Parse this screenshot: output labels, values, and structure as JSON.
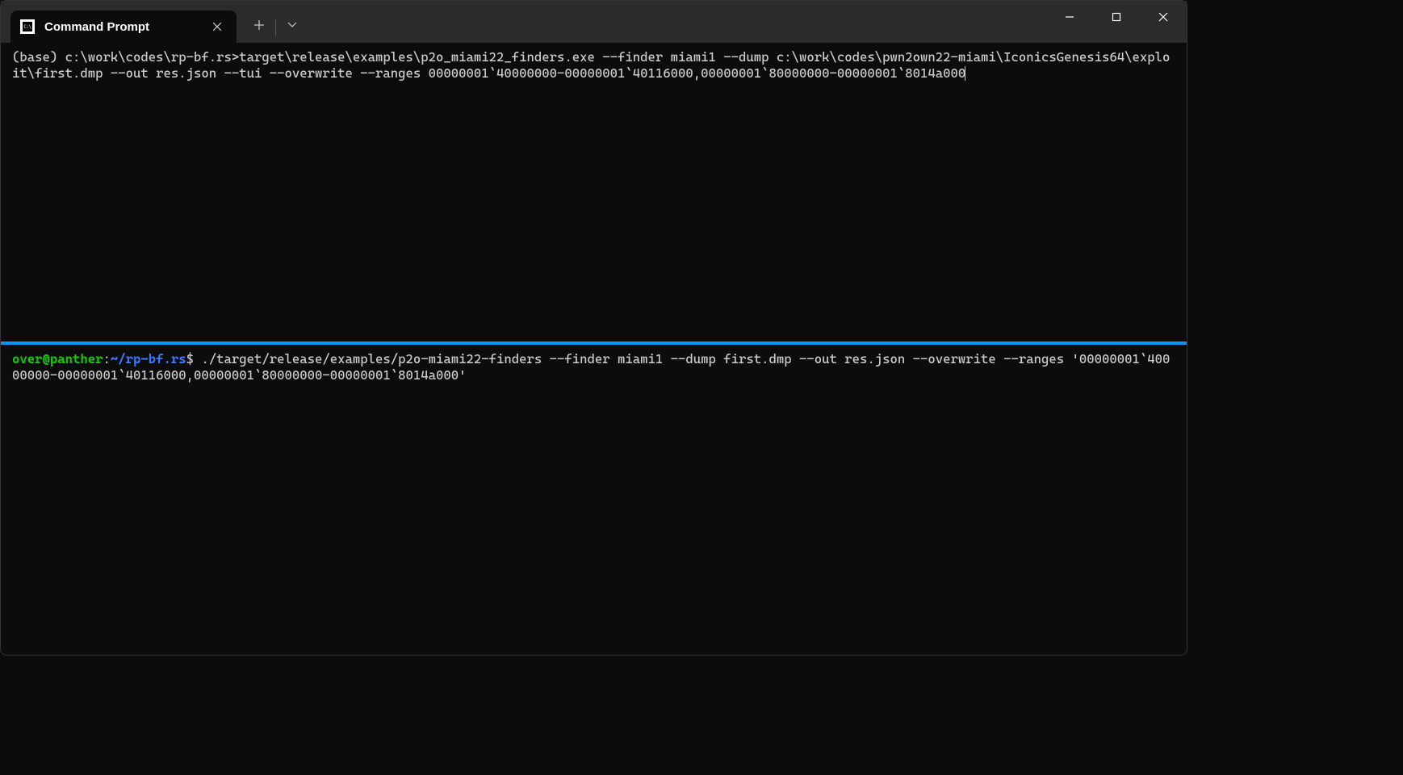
{
  "window": {
    "tab_title": "Command Prompt"
  },
  "top_pane": {
    "text": "(base) c:\\work\\codes\\rp-bf.rs>target\\release\\examples\\p2o_miami22_finders.exe --finder miami1 --dump c:\\work\\codes\\pwn2own22-miami\\IconicsGenesis64\\exploit\\first.dmp --out res.json --tui --overwrite --ranges 00000001`40000000-00000001`40116000,00000001`80000000-00000001`8014a000"
  },
  "bottom_pane": {
    "user": "over@panther",
    "colon": ":",
    "path": "~/rp-bf.rs",
    "dollar": "$",
    "command": " ./target/release/examples/p2o-miami22-finders --finder miami1 --dump first.dmp --out res.json --overwrite --ranges '00000001`40000000-00000001`40116000,00000001`80000000-00000001`8014a000'"
  }
}
